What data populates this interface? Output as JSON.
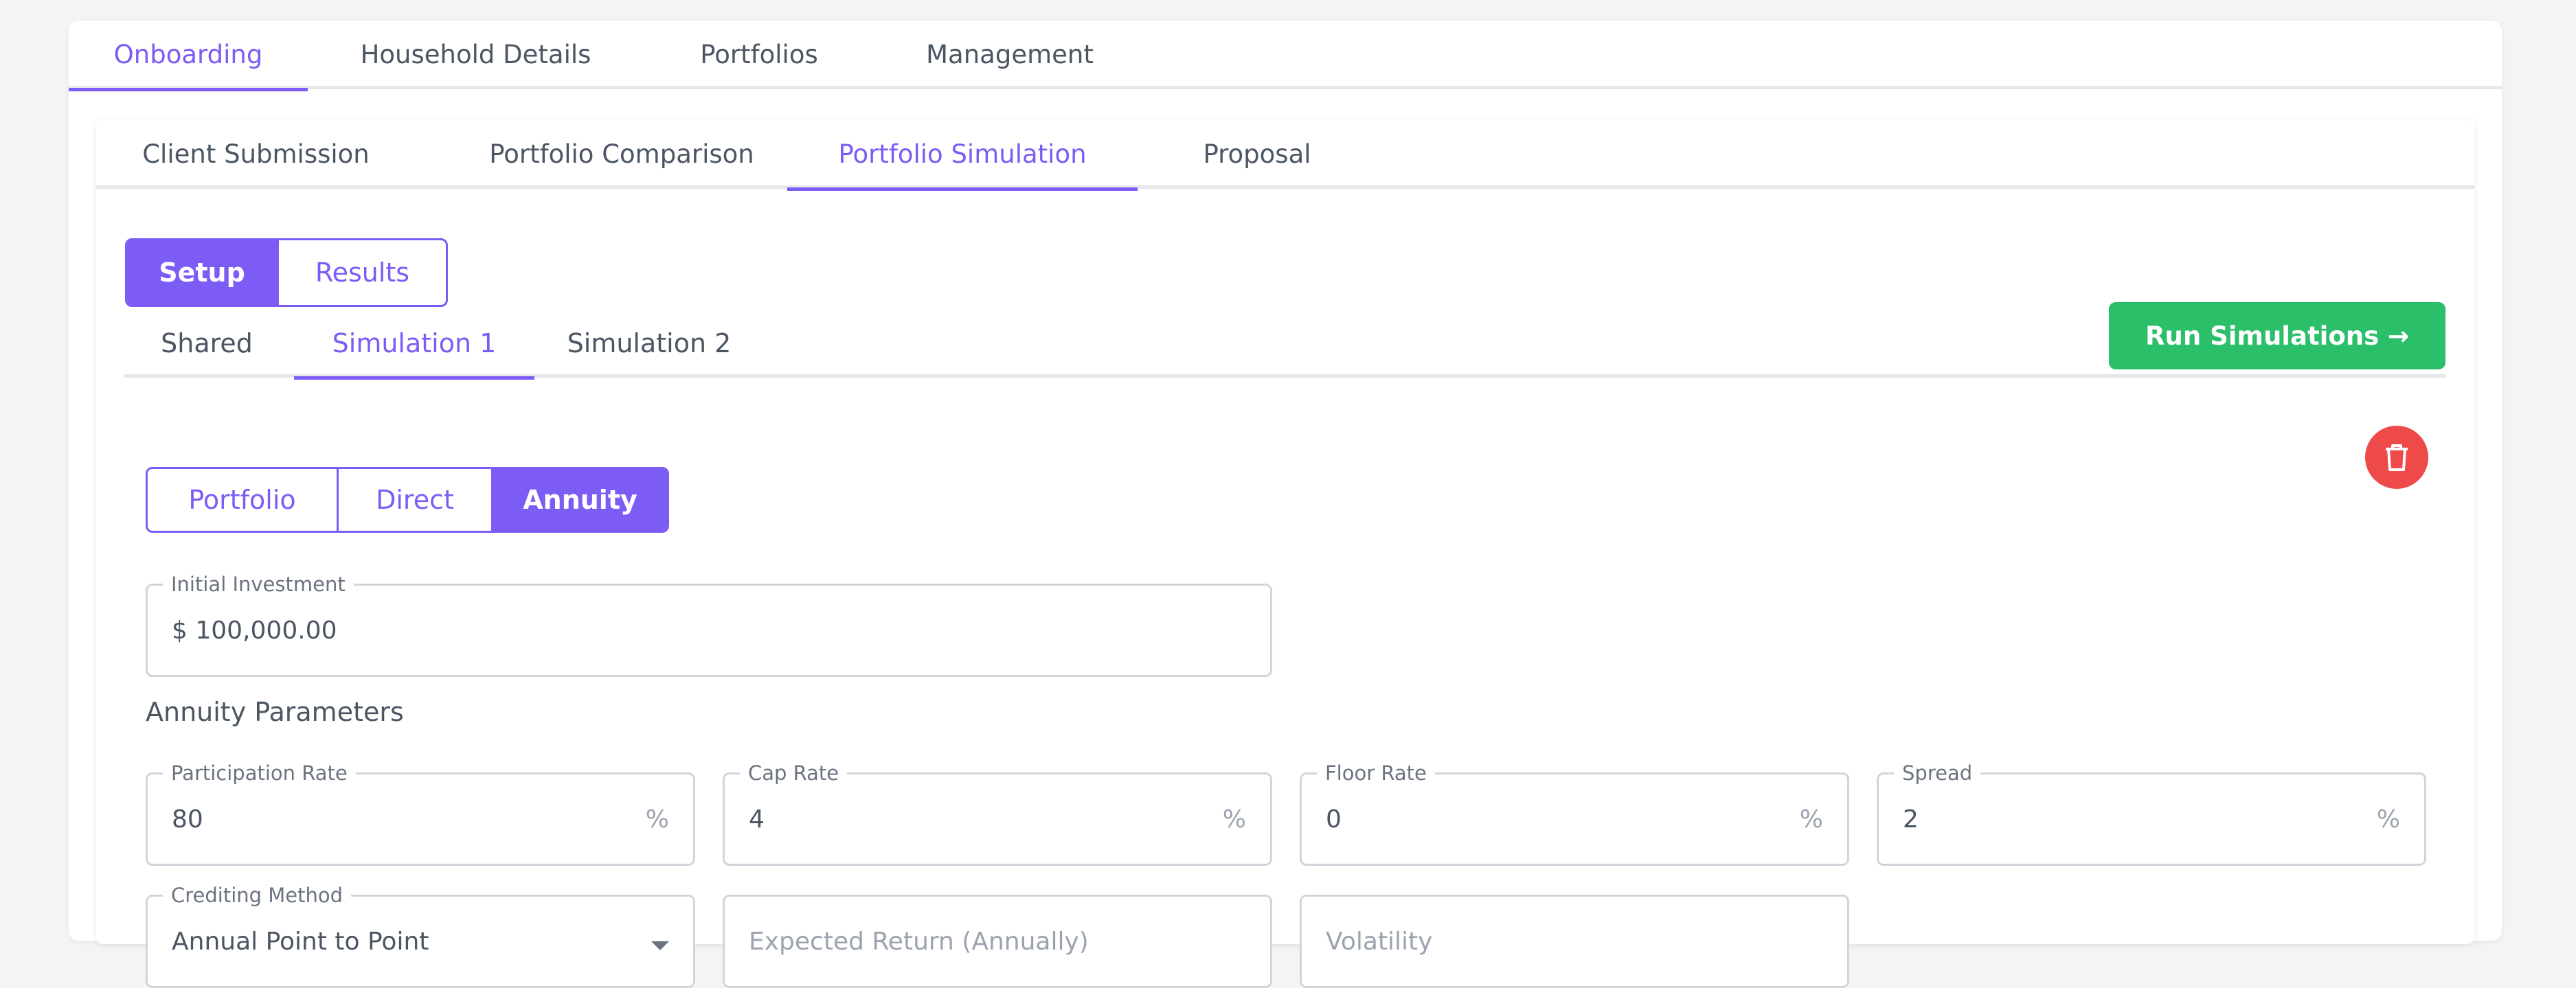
{
  "top_tabs": [
    "Onboarding",
    "Household Details",
    "Portfolios",
    "Management"
  ],
  "sub_tabs": [
    "Client Submission",
    "Portfolio Comparison",
    "Portfolio Simulation",
    "Proposal"
  ],
  "view_toggle": {
    "setup": "Setup",
    "results": "Results"
  },
  "sim_tabs": [
    "Shared",
    "Simulation 1",
    "Simulation 2"
  ],
  "run_button": "Run Simulations →",
  "type_toggle": {
    "portfolio": "Portfolio",
    "direct": "Direct",
    "annuity": "Annuity"
  },
  "initial_investment": {
    "label": "Initial Investment",
    "value": "$  100,000.00"
  },
  "annuity_section": "Annuity Parameters",
  "params": {
    "participation": {
      "label": "Participation Rate",
      "value": "80",
      "suffix": "%"
    },
    "cap": {
      "label": "Cap Rate",
      "value": "4",
      "suffix": "%"
    },
    "floor": {
      "label": "Floor Rate",
      "value": "0",
      "suffix": "%"
    },
    "spread": {
      "label": "Spread",
      "value": "2",
      "suffix": "%"
    }
  },
  "crediting": {
    "label": "Crediting Method",
    "value": "Annual Point to Point"
  },
  "expected_return": {
    "placeholder": "Expected Return (Annually)"
  },
  "volatility": {
    "placeholder": "Volatility"
  },
  "colors": {
    "accent": "#7c5cf5",
    "run": "#2cbf6a",
    "delete": "#ee4a4a"
  }
}
